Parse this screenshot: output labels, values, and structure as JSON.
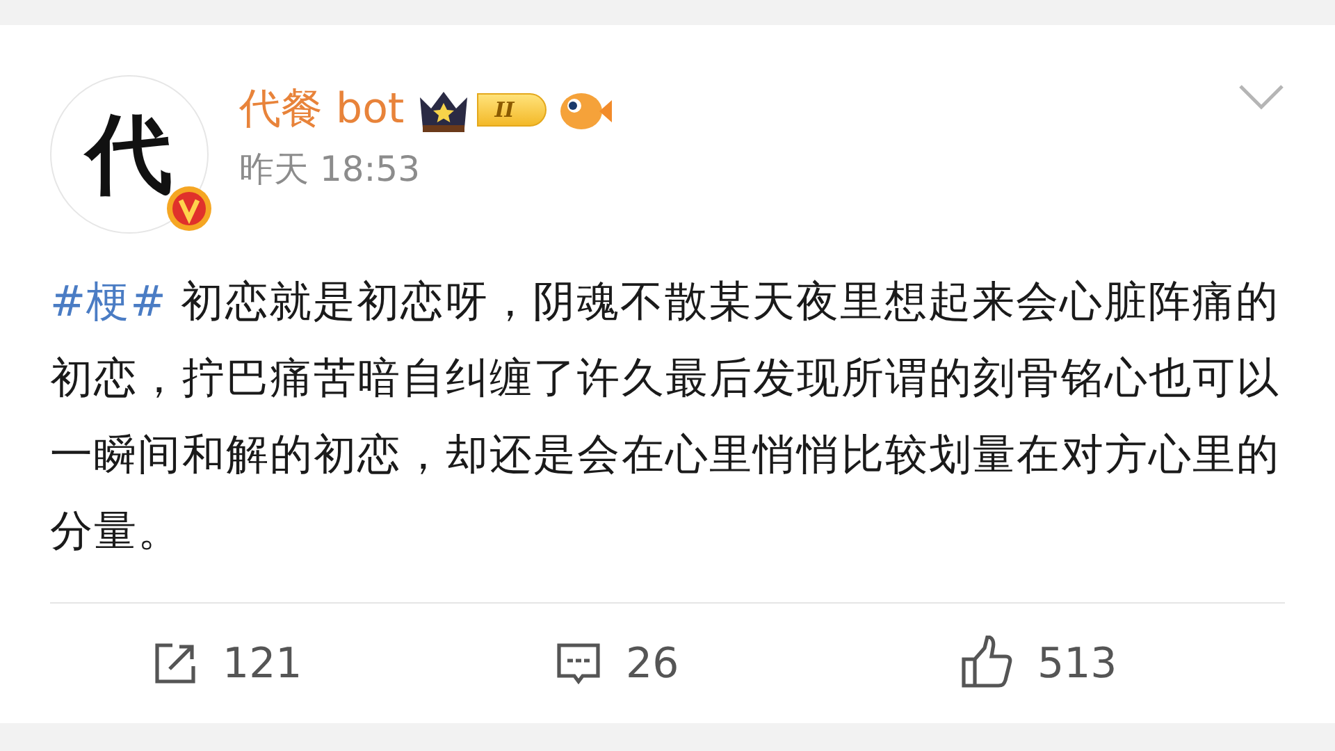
{
  "post": {
    "author": {
      "avatar_text": "代",
      "name": "代餐 bot",
      "verified": true,
      "level_badge": "II"
    },
    "time": "昨天 18:53",
    "hashtag": "#梗#",
    "text": "初恋就是初恋呀，阴魂不散某天夜里想起来会心脏阵痛的初恋，拧巴痛苦暗自纠缠了许久最后发现所谓的刻骨铭心也可以一瞬间和解的初恋，却还是会在心里悄悄比较划量在对方心里的分量。",
    "actions": [
      {
        "kind": "repost",
        "count": "121"
      },
      {
        "kind": "comment",
        "count": "26"
      },
      {
        "kind": "like",
        "count": "513"
      }
    ]
  }
}
